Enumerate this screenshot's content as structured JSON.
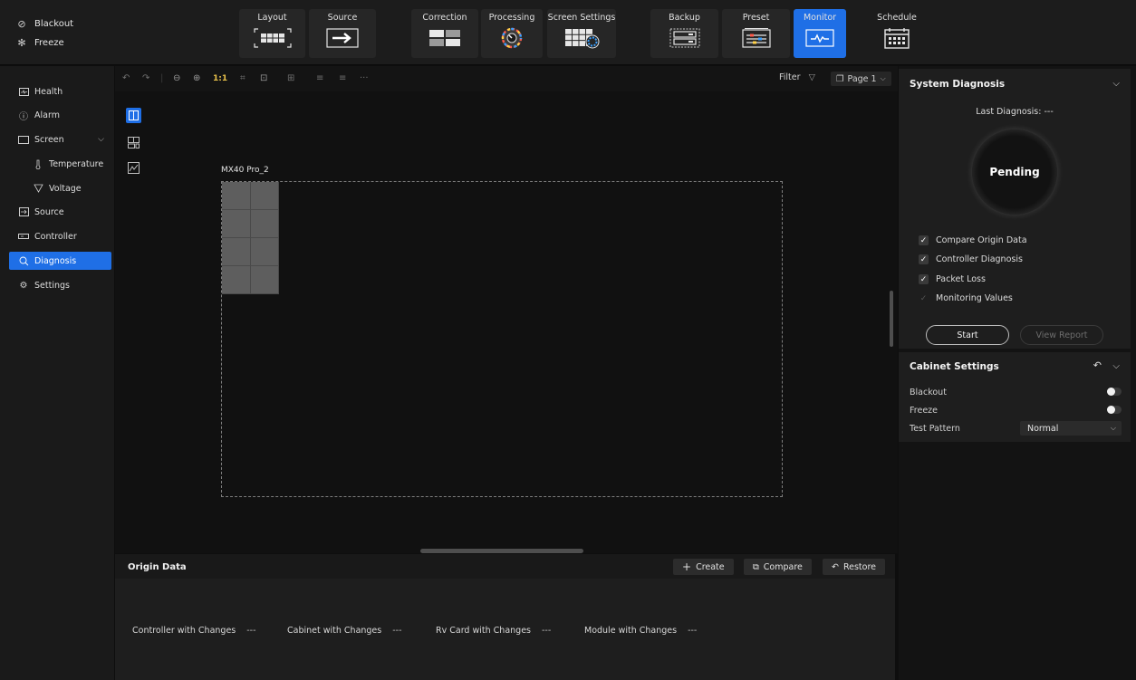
{
  "quick_controls": [
    {
      "label": "Blackout",
      "icon": "blackout-icon"
    },
    {
      "label": "Freeze",
      "icon": "freeze-icon"
    }
  ],
  "toolbar": {
    "tabs": [
      {
        "label": "Layout",
        "icon": "layout-icon"
      },
      {
        "label": "Source",
        "icon": "source-arrow-icon"
      },
      {
        "label": "Correction",
        "icon": "correction-icon"
      },
      {
        "label": "Processing",
        "icon": "processing-dial-icon"
      },
      {
        "label": "Screen Settings",
        "icon": "screen-settings-icon"
      },
      {
        "label": "Backup",
        "icon": "backup-icon"
      },
      {
        "label": "Preset",
        "icon": "preset-sliders-icon"
      },
      {
        "label": "Monitor",
        "icon": "monitor-pulse-icon",
        "active": true
      },
      {
        "label": "Schedule",
        "icon": "calendar-icon"
      }
    ],
    "active_color": "#1f6fe6"
  },
  "sidebar": {
    "items": [
      {
        "label": "Health",
        "icon": "health-icon"
      },
      {
        "label": "Alarm",
        "icon": "alarm-icon"
      },
      {
        "label": "Screen",
        "icon": "screen-icon",
        "expanded": true
      },
      {
        "label": "Temperature",
        "icon": "thermometer-icon"
      },
      {
        "label": "Voltage",
        "icon": "voltage-icon"
      },
      {
        "label": "Source",
        "icon": "source-icon"
      },
      {
        "label": "Controller",
        "icon": "controller-icon"
      },
      {
        "label": "Diagnosis",
        "icon": "diagnosis-icon",
        "active": true
      },
      {
        "label": "Settings",
        "icon": "settings-icon"
      }
    ]
  },
  "canvas": {
    "zoom_label": "1:1",
    "filter_label": "Filter",
    "page_label": "Page 1",
    "screen_name": "MX40 Pro_2",
    "cabinet_grid": {
      "columns": 2,
      "rows": 4
    }
  },
  "origin_data": {
    "title": "Origin Data",
    "buttons": {
      "create": "Create",
      "compare": "Compare",
      "restore": "Restore"
    },
    "stats": [
      {
        "label": "Controller with Changes",
        "value": "---"
      },
      {
        "label": "Cabinet with Changes",
        "value": "---"
      },
      {
        "label": "Rv Card with Changes",
        "value": "---"
      },
      {
        "label": "Module with Changes",
        "value": "---"
      }
    ]
  },
  "system_diagnosis": {
    "title": "System Diagnosis",
    "last_diagnosis": "Last Diagnosis: ---",
    "status": "Pending",
    "options": [
      {
        "label": "Compare Origin Data",
        "checked": true,
        "enabled": true
      },
      {
        "label": "Controller Diagnosis",
        "checked": true,
        "enabled": true
      },
      {
        "label": "Packet Loss",
        "checked": true,
        "enabled": true
      },
      {
        "label": "Monitoring Values",
        "checked": true,
        "enabled": false
      }
    ],
    "start_label": "Start",
    "view_report_label": "View Report"
  },
  "cabinet_settings": {
    "title": "Cabinet Settings",
    "blackout_label": "Blackout",
    "blackout_on": false,
    "freeze_label": "Freeze",
    "freeze_on": false,
    "test_pattern_label": "Test Pattern",
    "test_pattern_value": "Normal"
  }
}
